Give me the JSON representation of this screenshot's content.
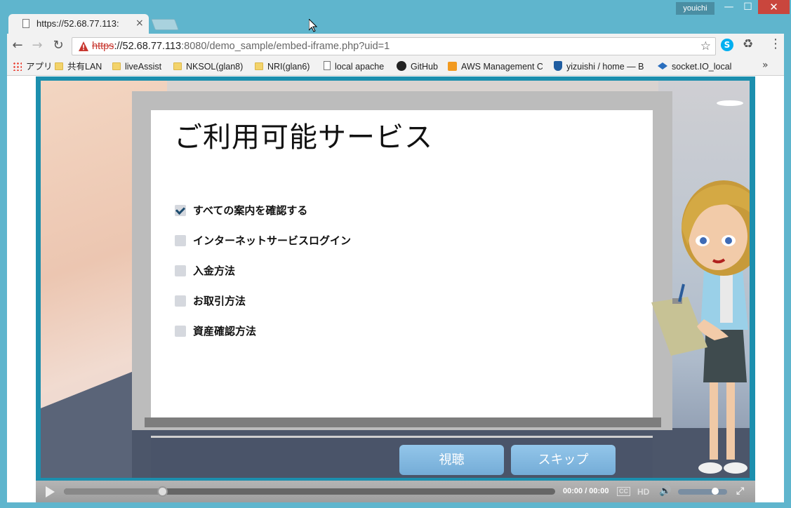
{
  "window": {
    "user": "youichi",
    "minimize_glyph": "—",
    "maximize_glyph": "☐",
    "close_glyph": "✕"
  },
  "tab": {
    "title": "https://52.68.77.113:",
    "close_glyph": "×"
  },
  "nav": {
    "back_glyph": "←",
    "forward_glyph": "→",
    "reload_glyph": "↻",
    "star_glyph": "☆",
    "menu_glyph": "⋮",
    "skype_glyph": "S",
    "recycle_glyph": "♻"
  },
  "address": {
    "scheme": "https",
    "host": "://52.68.77.113",
    "rest": ":8080/demo_sample/embed-iframe.php?uid=1"
  },
  "bookmarks": {
    "items": [
      {
        "label": "アプリ",
        "icon": "apps-icon"
      },
      {
        "label": "共有LAN",
        "icon": "folder-icon"
      },
      {
        "label": "liveAssist",
        "icon": "folder-icon"
      },
      {
        "label": "NKSOL(glan8)",
        "icon": "folder-icon"
      },
      {
        "label": "NRI(glan6)",
        "icon": "folder-icon"
      },
      {
        "label": "local apache",
        "icon": "page-icon"
      },
      {
        "label": "GitHub",
        "icon": "github-icon"
      },
      {
        "label": "AWS Management C",
        "icon": "aws-icon"
      },
      {
        "label": "yizuishi / home — B",
        "icon": "bitbucket-icon"
      },
      {
        "label": "socket.IO_local",
        "icon": "socketio-icon"
      }
    ],
    "more_glyph": "»"
  },
  "board": {
    "title": "ご利用可能サービス",
    "options": [
      {
        "label": "すべての案内を確認する",
        "checked": true
      },
      {
        "label": "インターネットサービスログイン",
        "checked": false
      },
      {
        "label": "入金方法",
        "checked": false
      },
      {
        "label": "お取引方法",
        "checked": false
      },
      {
        "label": "資産確認方法",
        "checked": false
      }
    ]
  },
  "buttons": {
    "watch": "視聴",
    "skip": "スキップ"
  },
  "player": {
    "time": "00:00 / 00:00",
    "cc": "CC",
    "hd": "HD",
    "volume_glyph": "🔊",
    "fullscreen_glyph": "⤢",
    "progress": 0.2,
    "volume": 0.75
  },
  "colors": {
    "accent": "#1c8fae",
    "button": "#7ab4df",
    "checkmark": "#1d4c6e"
  }
}
